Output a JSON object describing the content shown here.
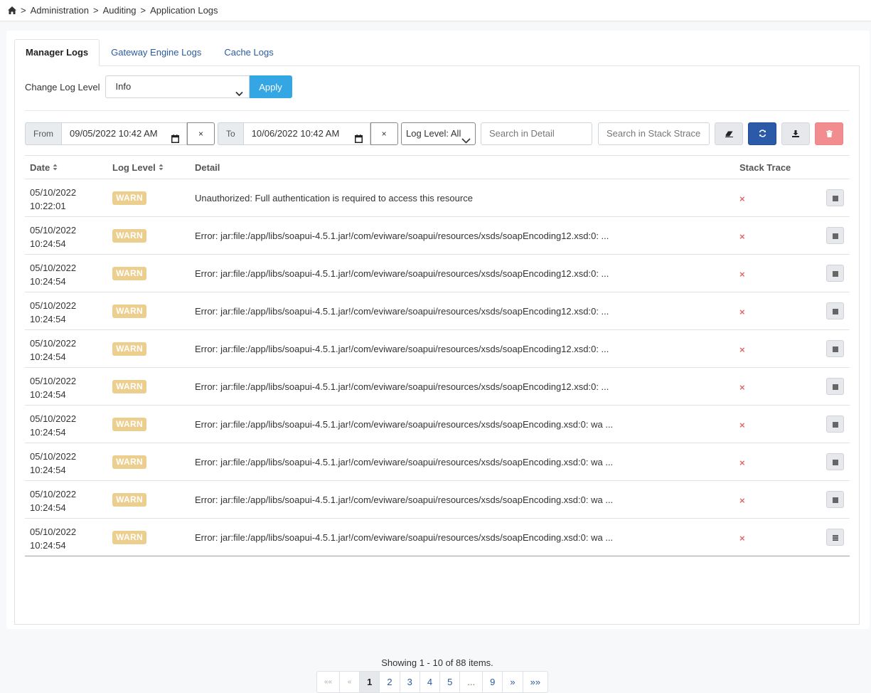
{
  "breadcrumb": [
    "Administration",
    "Auditing",
    "Application Logs"
  ],
  "breadcrumb_separator": ">",
  "tabs": [
    {
      "label": "Manager Logs",
      "active": true
    },
    {
      "label": "Gateway Engine Logs",
      "active": false
    },
    {
      "label": "Cache Logs",
      "active": false
    }
  ],
  "log_level": {
    "label": "Change Log Level",
    "selected": "Info",
    "apply_label": "Apply"
  },
  "filters": {
    "from_label": "From",
    "from_value": "09/05/2022 10:42 AM",
    "to_label": "To",
    "to_value": "10/06/2022 10:42 AM",
    "clear_symbol": "×",
    "level_select": "Log Level: All",
    "search_detail_placeholder": "Search in Detail",
    "search_stack_placeholder": "Search in Stack Strace"
  },
  "table": {
    "headers": {
      "date": "Date",
      "log_level": "Log Level",
      "detail": "Detail",
      "stack_trace": "Stack Trace"
    },
    "rows": [
      {
        "date": "05/10/2022",
        "time": "10:22:01",
        "level": "WARN",
        "detail": "Unauthorized: Full authentication is required to access this resource",
        "stack": "×"
      },
      {
        "date": "05/10/2022",
        "time": "10:24:54",
        "level": "WARN",
        "detail": "Error: jar:file:/app/libs/soapui-4.5.1.jar!/com/eviware/soapui/resources/xsds/soapEncoding12.xsd:0: ...",
        "stack": "×"
      },
      {
        "date": "05/10/2022",
        "time": "10:24:54",
        "level": "WARN",
        "detail": "Error: jar:file:/app/libs/soapui-4.5.1.jar!/com/eviware/soapui/resources/xsds/soapEncoding12.xsd:0: ...",
        "stack": "×"
      },
      {
        "date": "05/10/2022",
        "time": "10:24:54",
        "level": "WARN",
        "detail": "Error: jar:file:/app/libs/soapui-4.5.1.jar!/com/eviware/soapui/resources/xsds/soapEncoding12.xsd:0: ...",
        "stack": "×"
      },
      {
        "date": "05/10/2022",
        "time": "10:24:54",
        "level": "WARN",
        "detail": "Error: jar:file:/app/libs/soapui-4.5.1.jar!/com/eviware/soapui/resources/xsds/soapEncoding12.xsd:0: ...",
        "stack": "×"
      },
      {
        "date": "05/10/2022",
        "time": "10:24:54",
        "level": "WARN",
        "detail": "Error: jar:file:/app/libs/soapui-4.5.1.jar!/com/eviware/soapui/resources/xsds/soapEncoding12.xsd:0: ...",
        "stack": "×"
      },
      {
        "date": "05/10/2022",
        "time": "10:24:54",
        "level": "WARN",
        "detail": "Error: jar:file:/app/libs/soapui-4.5.1.jar!/com/eviware/soapui/resources/xsds/soapEncoding.xsd:0: wa ...",
        "stack": "×"
      },
      {
        "date": "05/10/2022",
        "time": "10:24:54",
        "level": "WARN",
        "detail": "Error: jar:file:/app/libs/soapui-4.5.1.jar!/com/eviware/soapui/resources/xsds/soapEncoding.xsd:0: wa ...",
        "stack": "×"
      },
      {
        "date": "05/10/2022",
        "time": "10:24:54",
        "level": "WARN",
        "detail": "Error: jar:file:/app/libs/soapui-4.5.1.jar!/com/eviware/soapui/resources/xsds/soapEncoding.xsd:0: wa ...",
        "stack": "×"
      },
      {
        "date": "05/10/2022",
        "time": "10:24:54",
        "level": "WARN",
        "detail": "Error: jar:file:/app/libs/soapui-4.5.1.jar!/com/eviware/soapui/resources/xsds/soapEncoding.xsd:0: wa ...",
        "stack": "×"
      }
    ]
  },
  "pagination": {
    "summary": "Showing 1 - 10 of 88 items.",
    "items": [
      "««",
      "«",
      "1",
      "2",
      "3",
      "4",
      "5",
      "...",
      "9",
      "»",
      "»»"
    ],
    "active": "1"
  },
  "colors": {
    "warn_badge": "#ecce8e",
    "apply_button": "#33a6e3",
    "refresh_button": "#2a5aa8",
    "delete_button": "#f18d8f",
    "no_stack": "#e56767"
  }
}
